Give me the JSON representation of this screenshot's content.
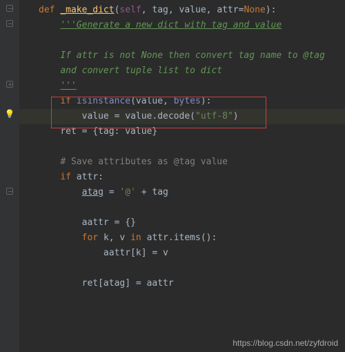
{
  "gutter": {
    "bulb_line": 7
  },
  "code": {
    "def_kw": "def ",
    "fn_name": "_make_dict",
    "sig_open": "(",
    "self": "self",
    "comma_sp": ", ",
    "p_tag": "tag",
    "p_value": "value",
    "p_attr": "attr",
    "eq": "=",
    "none": "None",
    "sig_close": "):",
    "doc1": "'''Generate a new dict with tag and value",
    "doc2": "",
    "doc3": "If attr is not None then convert tag name to @tag",
    "doc4": "and convert tuple list to dict",
    "doc5": "'''",
    "if_kw": "if ",
    "isinstance": "isinstance",
    "paren_o": "(",
    "paren_c": ")",
    "bytes": "bytes",
    "colon": ":",
    "assign_value": "value = value.decode(",
    "utf8": "\"utf-8\"",
    "ret_assign": "ret = {tag: value}",
    "comment_attr": "# Save attributes as @tag value",
    "if_attr": "if ",
    "attr_colon": "attr:",
    "atag": "atag",
    "atag_rhs": " = ",
    "at_str": "'@'",
    "plus_tag": " + tag",
    "aattr_init": "aattr = {}",
    "for_kw": "for ",
    "k": "k",
    "v": "v",
    "in_kw": " in ",
    "attr_items": "attr.items():",
    "aattr_assign": "aattr[k] = v",
    "ret_atag": "ret[atag] = aattr"
  },
  "watermark": "https://blog.csdn.net/zyfdroid"
}
